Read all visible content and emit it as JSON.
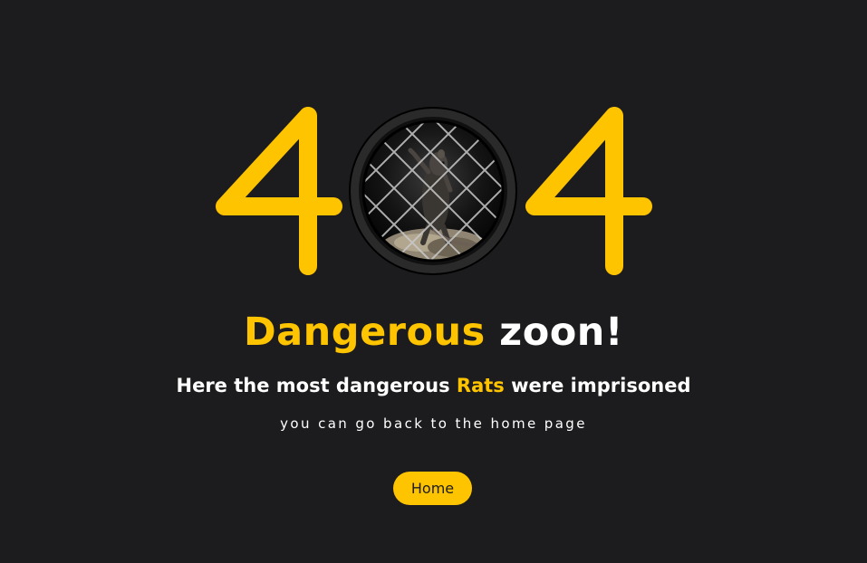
{
  "error": {
    "digit_left": "4",
    "digit_middle": "0",
    "digit_right": "4"
  },
  "headline": {
    "accent": "Dangerous",
    "rest": " zoon!"
  },
  "subtitle": {
    "before": "Here the most dangerous ",
    "accent": "Rats",
    "after": " were imprisoned"
  },
  "hint": "you can go back to the home page",
  "button": {
    "label": "Home"
  },
  "colors": {
    "background": "#1c1c1e",
    "accent": "#ffc400",
    "text": "#ffffff"
  }
}
